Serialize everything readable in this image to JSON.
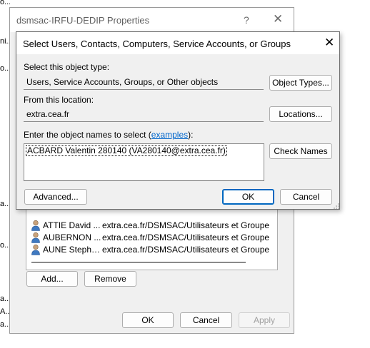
{
  "background_edge_text": [
    "o...",
    "ni...",
    "o...",
    "a...",
    "o...",
    "a...",
    "A...",
    "a..."
  ],
  "properties": {
    "title": "dsmsac-IRFU-DEDIP Properties",
    "help_label": "?",
    "close_label": "✕",
    "members": [
      {
        "name": "ATTIE David ...",
        "path": "extra.cea.fr/DSMSAC/Utilisateurs et Groupes/Us"
      },
      {
        "name": "AUBERNON ...",
        "path": "extra.cea.fr/DSMSAC/Utilisateurs et Groupes/Us"
      },
      {
        "name": "AUNE Stepha...",
        "path": "extra.cea.fr/DSMSAC/Utilisateurs et Groupes/Us"
      }
    ],
    "add_label": "Add...",
    "remove_label": "Remove",
    "ok_label": "OK",
    "cancel_label": "Cancel",
    "apply_label": "Apply"
  },
  "select_dialog": {
    "title": "Select Users, Contacts, Computers, Service Accounts, or Groups",
    "close_label": "✕",
    "object_type_label": "Select this object type:",
    "object_type_value": "Users, Service Accounts, Groups, or Other objects",
    "object_types_button": "Object Types...",
    "location_label": "From this location:",
    "location_value": "extra.cea.fr",
    "locations_button": "Locations...",
    "names_label_prefix": "Enter the object names to select (",
    "names_label_link": "examples",
    "names_label_suffix": "):",
    "names_value": "ACBARD Valentin 280140 (VA280140@extra.cea.fr)",
    "check_names_button": "Check Names",
    "advanced_button": "Advanced...",
    "ok_button": "OK",
    "cancel_button": "Cancel"
  },
  "colors": {
    "dialog_bg": "#f0f0f0",
    "accent": "#0067c0",
    "link": "#0066cc"
  }
}
